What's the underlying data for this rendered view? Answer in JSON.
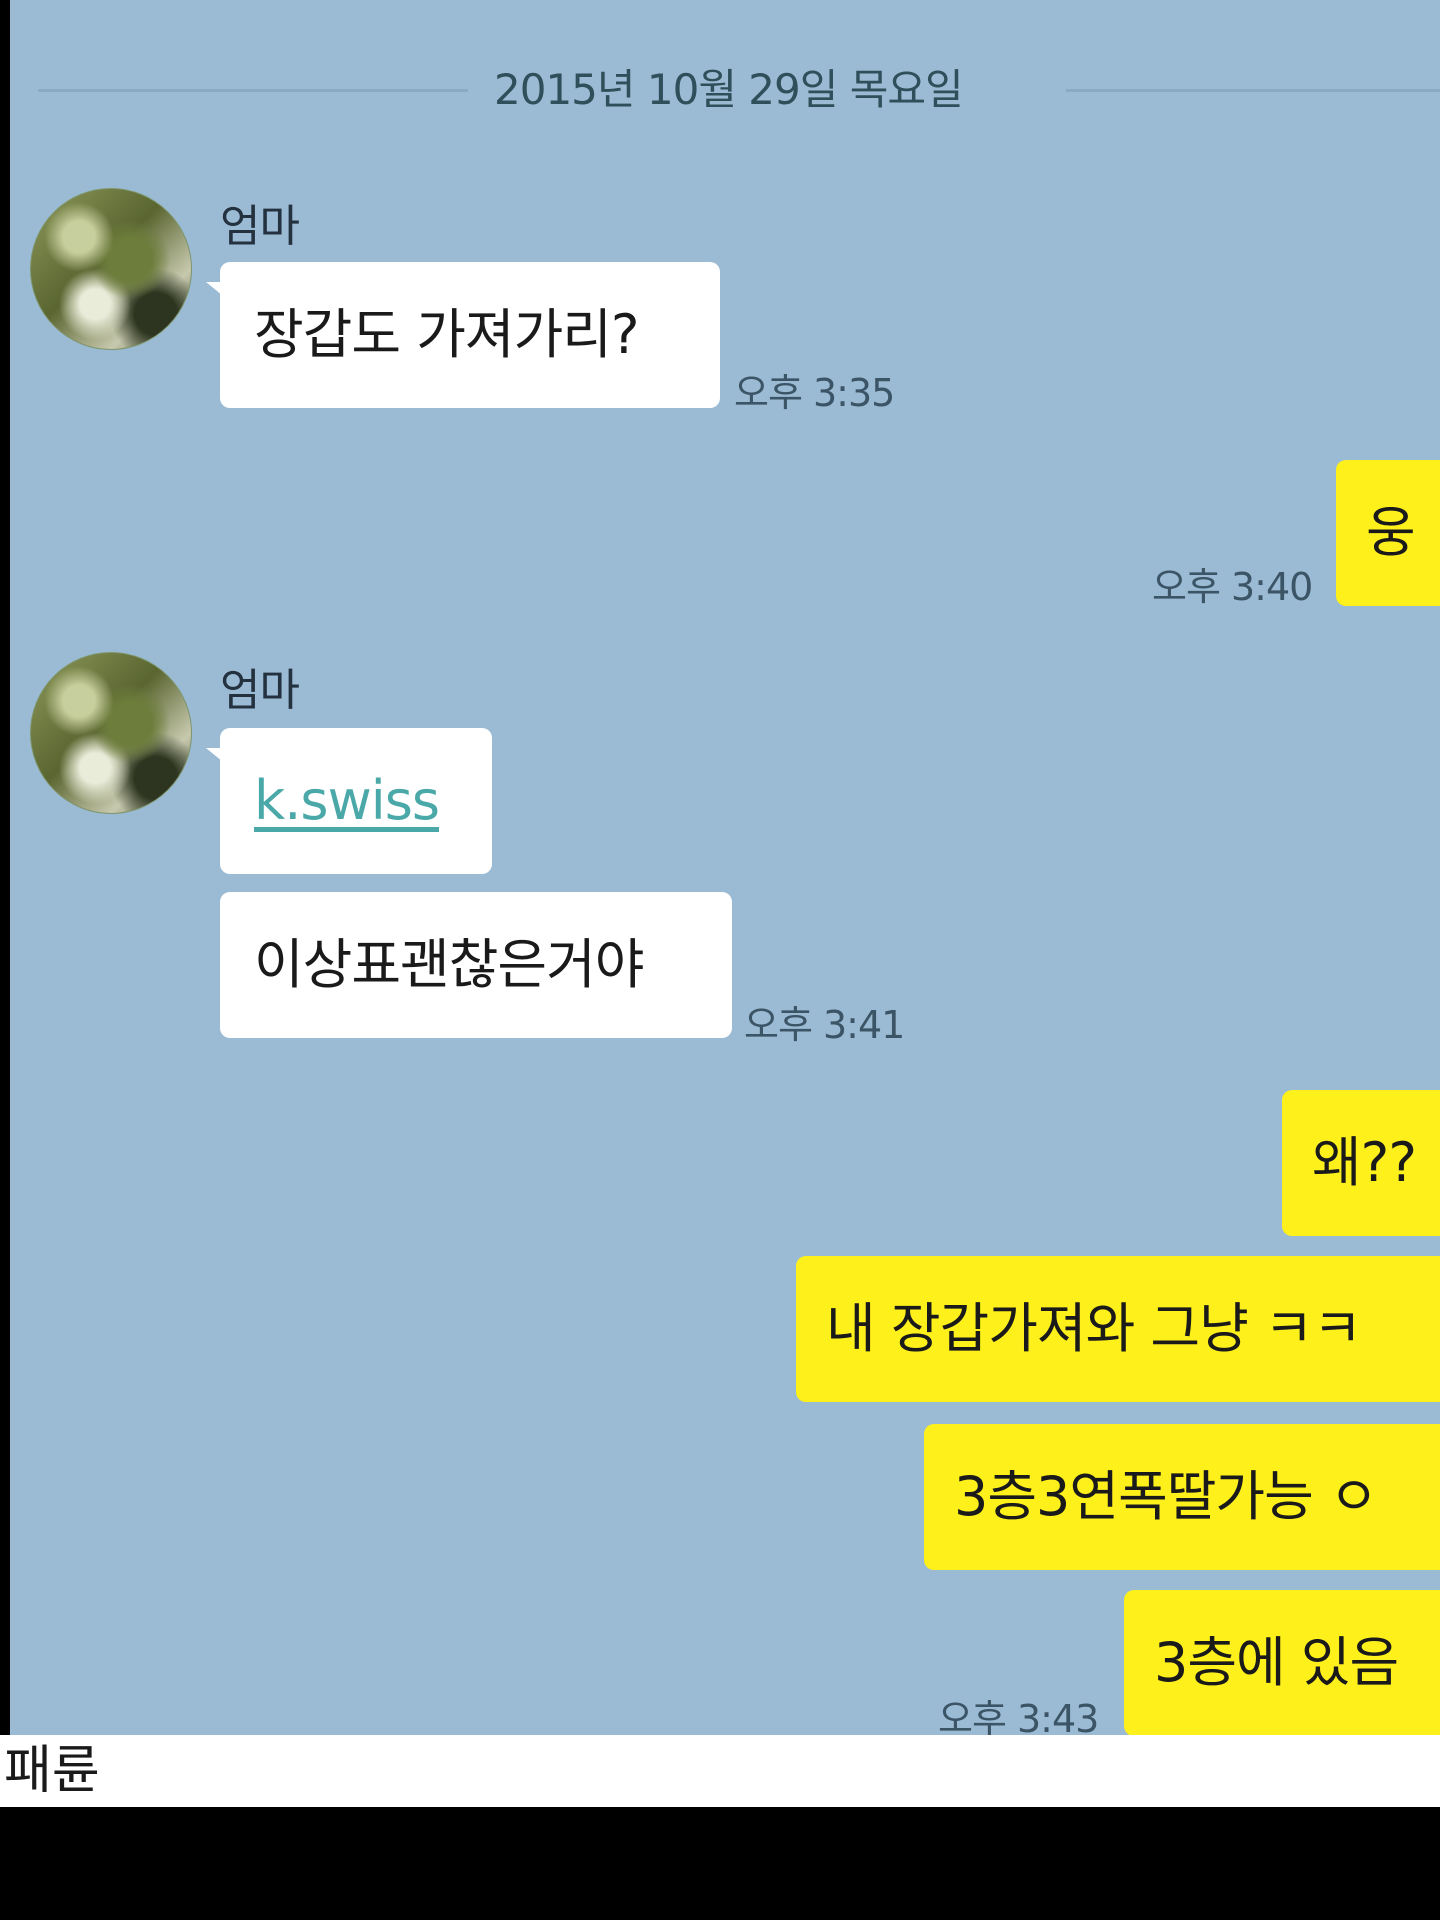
{
  "chat": {
    "date_divider": "2015년 10월 29일 목요일",
    "messages": {
      "m1_sender": "엄마",
      "m1_text": "장갑도 가져가리?",
      "m1_time": "오후 3:35",
      "m2_text": "웅",
      "m2_time": "오후 3:40",
      "m3_sender": "엄마",
      "m3_link": "k.swiss",
      "m4_text": "이상표괜찮은거야",
      "m4_time": "오후 3:41",
      "m5_text": "왜??",
      "m6_text": "내 장갑가져와 그냥 ㅋㅋ",
      "m7_text": "3층3연폭딸가능 ㅇ",
      "m8_text": "3층에 있음",
      "m8_time": "오후 3:43"
    }
  },
  "caption": "패륜",
  "colors": {
    "chat_background": "#9bbbd4",
    "incoming_bubble": "#ffffff",
    "outgoing_bubble": "#fef01b",
    "link": "#4aa9a8"
  }
}
